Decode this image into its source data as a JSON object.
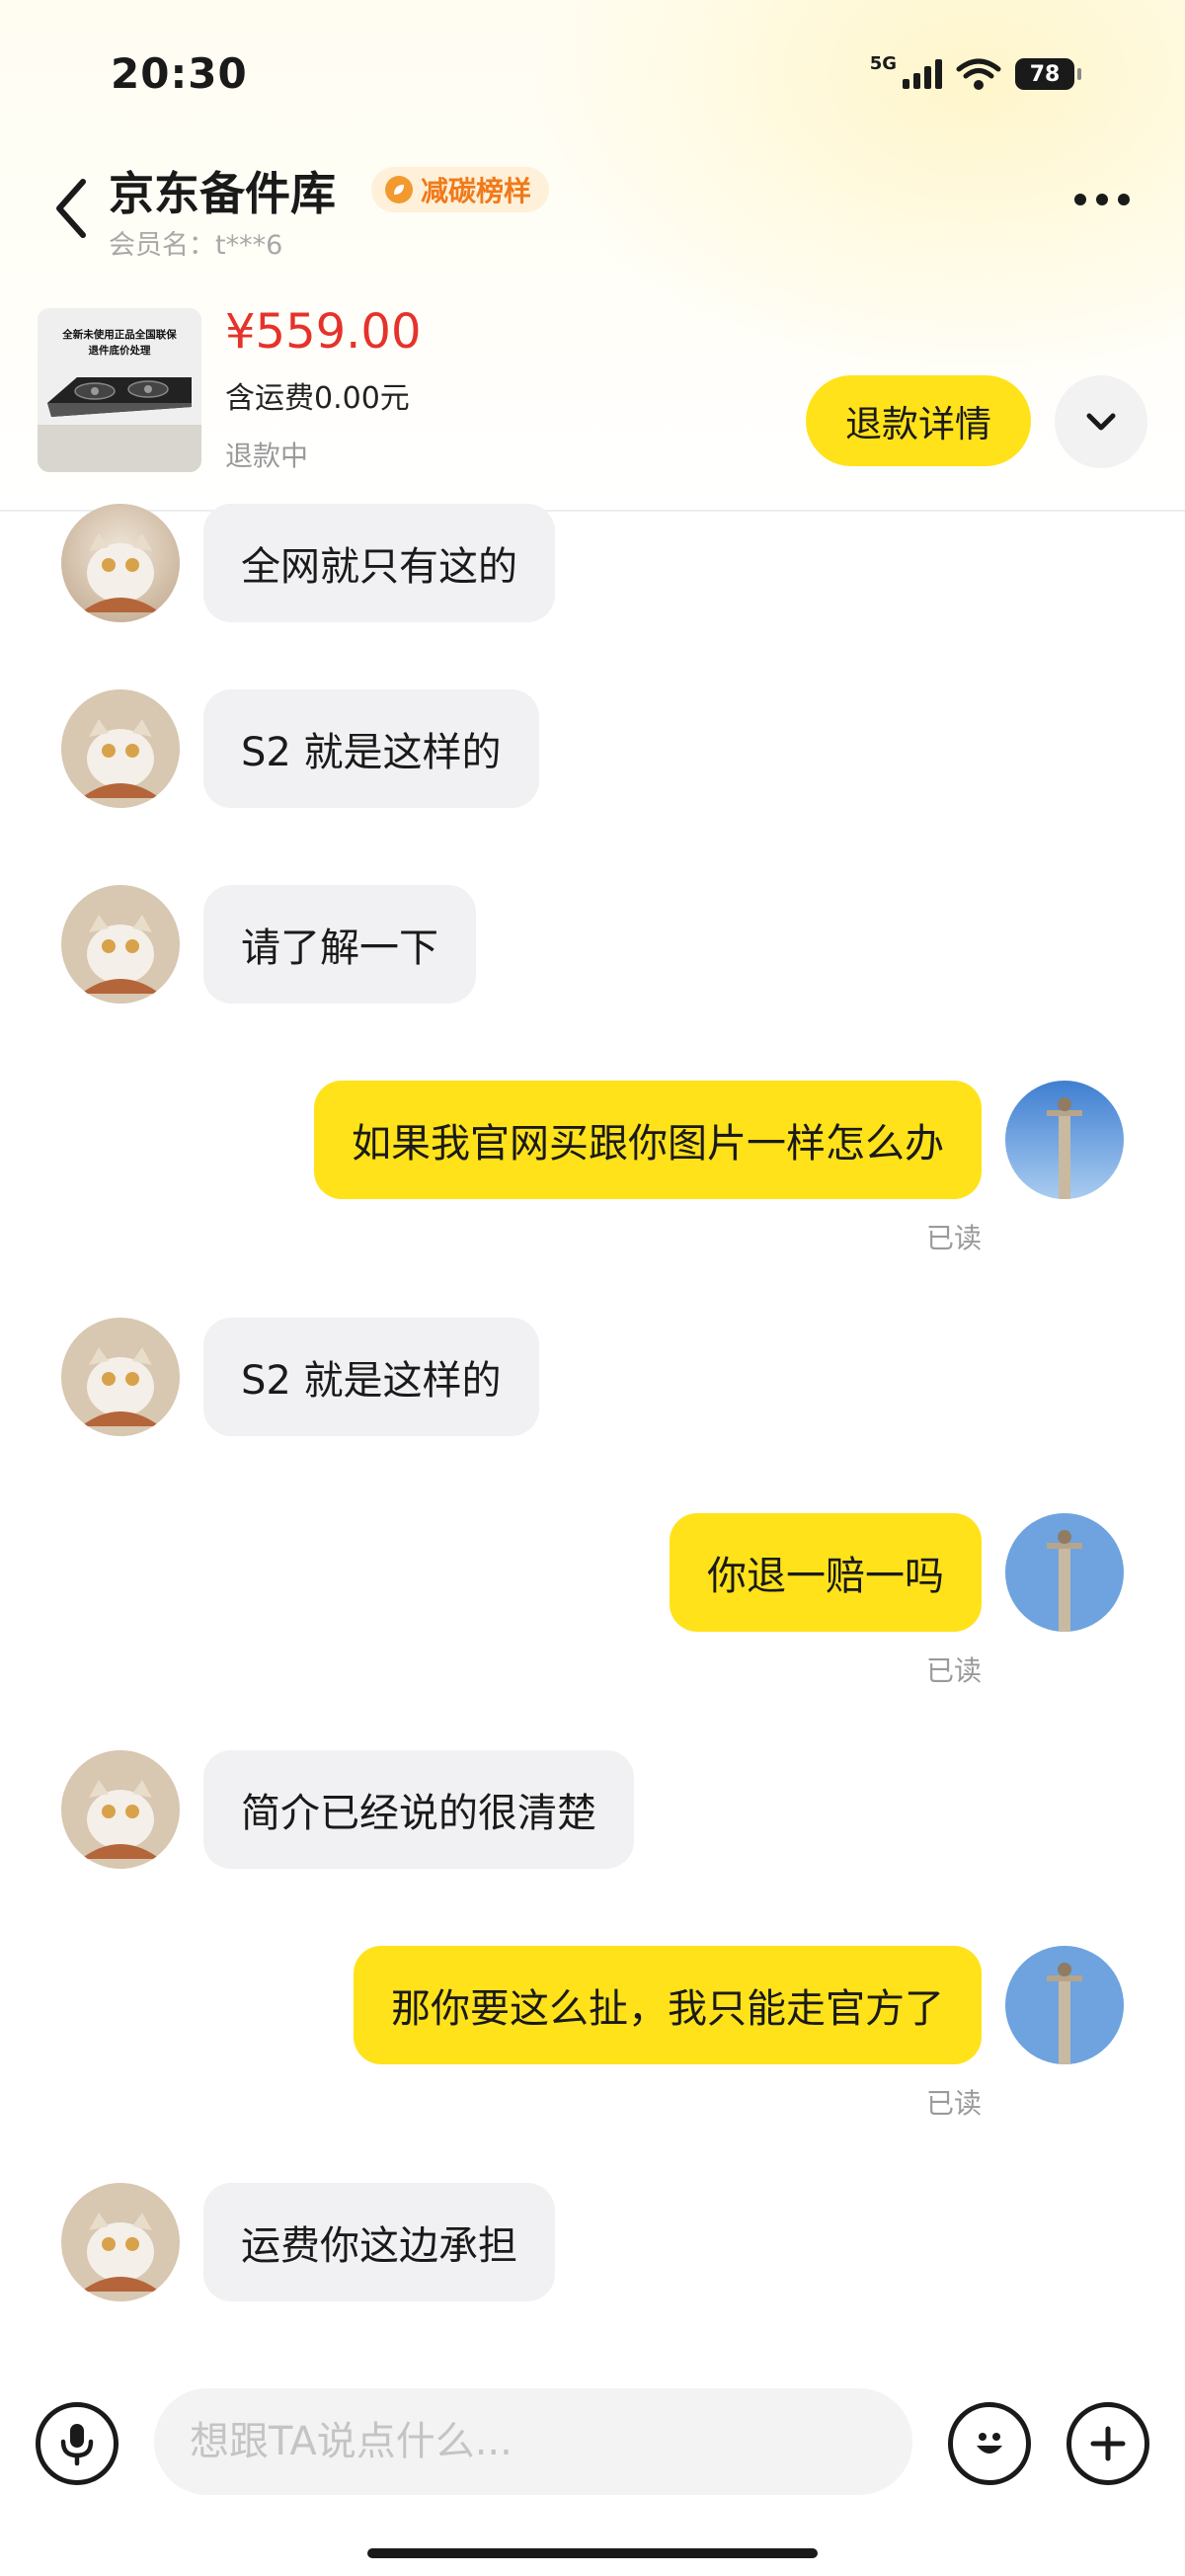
{
  "status_bar": {
    "time": "20:30",
    "network": "5G",
    "battery": "78"
  },
  "header": {
    "shop_name": "京东备件库",
    "badge": "减碳榜样",
    "member": "会员名：t***6"
  },
  "product": {
    "thumb_caption_1": "全新未使用正品全国联保",
    "thumb_caption_2": "退件底价处理",
    "price": "¥559.00",
    "shipping": "含运费0.00元",
    "status": "退款中",
    "refund_button": "退款详情"
  },
  "messages": [
    {
      "side": "in",
      "text": "全网就只有这的"
    },
    {
      "side": "in",
      "text": "S2 就是这样的"
    },
    {
      "side": "in",
      "text": "请了解一下"
    },
    {
      "side": "out",
      "text": "如果我官网买跟你图片一样怎么办",
      "status": "已读"
    },
    {
      "side": "in",
      "text": "S2 就是这样的"
    },
    {
      "side": "out",
      "text": "你退一赔一吗",
      "status": "已读"
    },
    {
      "side": "in",
      "text": "简介已经说的很清楚"
    },
    {
      "side": "out",
      "text": "那你要这么扯，我只能走官方了",
      "status": "已读"
    },
    {
      "side": "in",
      "text": "运费你这边承担"
    }
  ],
  "input": {
    "placeholder": "想跟TA说点什么..."
  },
  "icons": {
    "back": "chevron-left-icon",
    "more": "more-dots-icon",
    "expand": "chevron-down-icon",
    "mic": "microphone-icon",
    "emoji": "emoji-icon",
    "plus": "plus-icon"
  },
  "colors": {
    "accent": "#ffe21a",
    "price": "#e5322b",
    "badge": "#f07a1a"
  }
}
